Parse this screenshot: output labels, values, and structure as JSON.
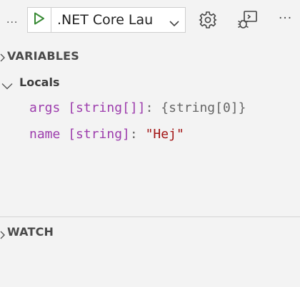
{
  "toolbar": {
    "overflow_left": "...",
    "launch_config": ".NET Core Lau",
    "overflow_right": "···",
    "icons": {
      "play": "play-icon",
      "dropdown": "chevron-down-icon",
      "settings": "gear-icon",
      "debug_console": "debug-console-icon",
      "more": "more-icon"
    }
  },
  "variables": {
    "title": "VARIABLES",
    "locals_label": "Locals",
    "items": [
      {
        "name": "args",
        "type": "[string[]]",
        "colon": ":",
        "value": "{string[0]}"
      },
      {
        "name": "name",
        "type": "[string]",
        "colon": ":",
        "value": "\"Hej\""
      }
    ]
  },
  "watch": {
    "title": "WATCH"
  },
  "colors": {
    "play_green": "#388a34",
    "var_name_purple": "#9d3dad",
    "string_red": "#a31515"
  }
}
